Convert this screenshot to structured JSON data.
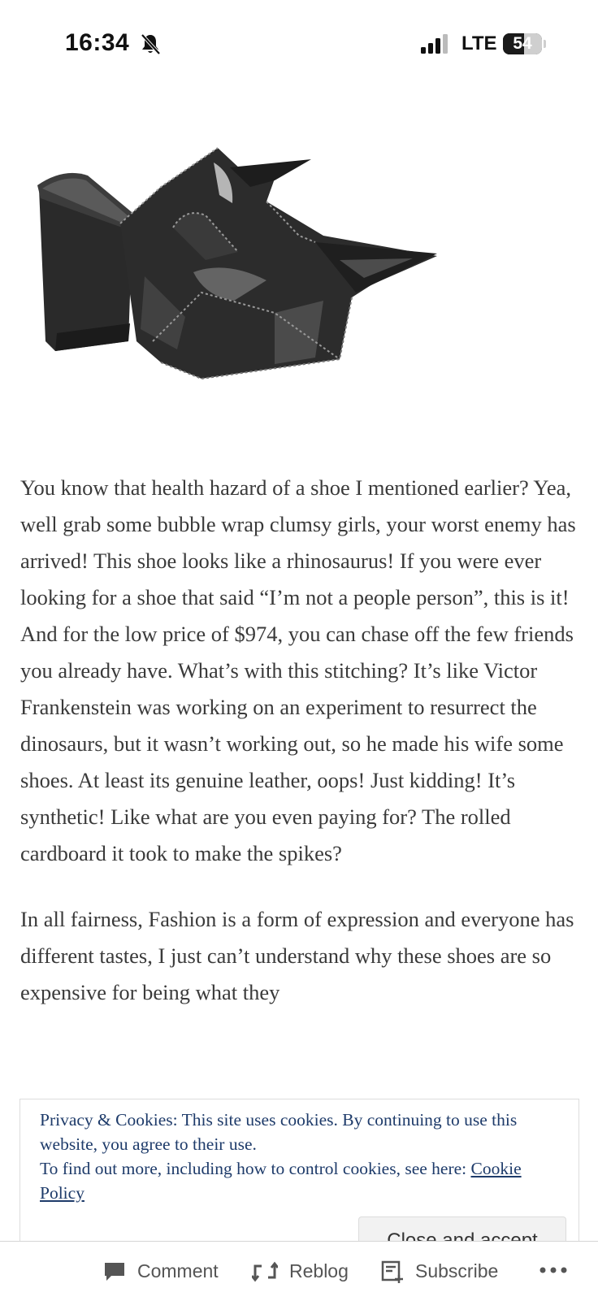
{
  "status_bar": {
    "time": "16:34",
    "network": "LTE",
    "battery_level": "54",
    "battery_fraction": 0.54,
    "icons": [
      "silent-bell-icon",
      "signal-icon",
      "battery-icon"
    ]
  },
  "article": {
    "paragraphs": [
      "You know that health hazard of a shoe I mentioned earlier? Yea, well grab some bubble wrap clumsy girls, your worst enemy has arrived! This shoe looks like a rhinosaurus! If you were ever looking for a shoe that said “I’m not a people person”, this is it! And for the low price of $974, you can chase off the few friends you already have. What’s with this stitching? It’s like Victor Frankenstein was working on an experiment to resurrect the dinosaurs, but it wasn’t working out, so he made his wife some shoes. At least its genuine leather, oops! Just kidding! It’s synthetic! Like what are you even paying for? The rolled cardboard it took to make the spikes?",
      "In all fairness, Fashion is a form of expression and everyone has different tastes, I just can’t understand why these shoes are so expensive for being what they"
    ]
  },
  "cookie_banner": {
    "line1": "Privacy & Cookies: This site uses cookies. By continuing to use this website, you agree to their use.",
    "line2": "To find out more, including how to control cookies, see here: ",
    "link_text": "Cookie Policy",
    "button_label": "Close and accept"
  },
  "action_bar": {
    "comment_label": "Comment",
    "reblog_label": "Reblog",
    "subscribe_label": "Subscribe",
    "more_label": "•••"
  },
  "colors": {
    "text": "#3a3a3a",
    "cookie_text": "#1e3b6a",
    "action_text": "#555555"
  }
}
